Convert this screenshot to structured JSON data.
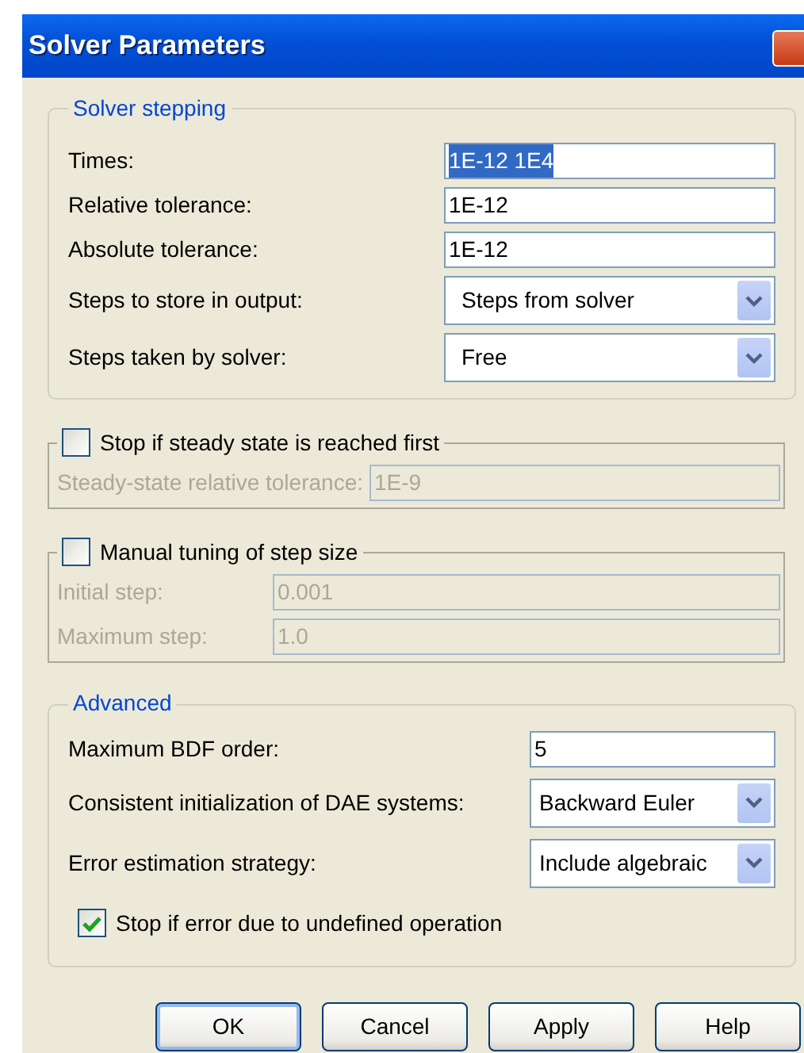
{
  "window": {
    "title": "Solver Parameters"
  },
  "groups": [
    {
      "kind": "titled",
      "title": "Solver stepping",
      "rows": [
        {
          "kind": "field",
          "label": "Times:",
          "value": "1E-12 1E4",
          "disabled": false,
          "text_selected": true
        },
        {
          "kind": "field",
          "label": "Relative tolerance:",
          "value": "1E-12",
          "disabled": false,
          "text_selected": false
        },
        {
          "kind": "field",
          "label": "Absolute tolerance:",
          "value": "1E-12",
          "disabled": false,
          "text_selected": false
        },
        {
          "kind": "select",
          "label": "Steps to store in output:",
          "value": "Steps from solver",
          "disabled": false
        },
        {
          "kind": "select",
          "label": "Steps taken by solver:",
          "value": "Free",
          "disabled": false
        }
      ]
    },
    {
      "kind": "checkbox",
      "title": "Stop if steady state is reached first",
      "checked": false,
      "rows": [
        {
          "kind": "field",
          "label": "Steady-state relative tolerance:",
          "value": "1E-9",
          "disabled": true,
          "text_selected": false
        }
      ]
    },
    {
      "kind": "checkbox",
      "title": "Manual tuning of step size",
      "checked": false,
      "rows": [
        {
          "kind": "field",
          "label": "Initial step:",
          "value": "0.001",
          "disabled": true,
          "text_selected": false
        },
        {
          "kind": "field",
          "label": "Maximum step:",
          "value": "1.0",
          "disabled": true,
          "text_selected": false
        }
      ]
    },
    {
      "kind": "titled",
      "title": "Advanced",
      "rows": [
        {
          "kind": "field",
          "label": "Maximum BDF order:",
          "value": "5",
          "disabled": false,
          "text_selected": false
        },
        {
          "kind": "select",
          "label": "Consistent initialization of DAE systems:",
          "value": "Backward Euler",
          "disabled": false
        },
        {
          "kind": "select",
          "label": "Error estimation strategy:",
          "value": "Include algebraic",
          "disabled": false
        },
        {
          "kind": "check",
          "label": "Stop if error due to undefined operation",
          "checked": true
        }
      ]
    }
  ],
  "buttons": [
    {
      "label": "OK",
      "default": true
    },
    {
      "label": "Cancel",
      "default": false
    },
    {
      "label": "Apply",
      "default": false
    },
    {
      "label": "Help",
      "default": false
    }
  ]
}
